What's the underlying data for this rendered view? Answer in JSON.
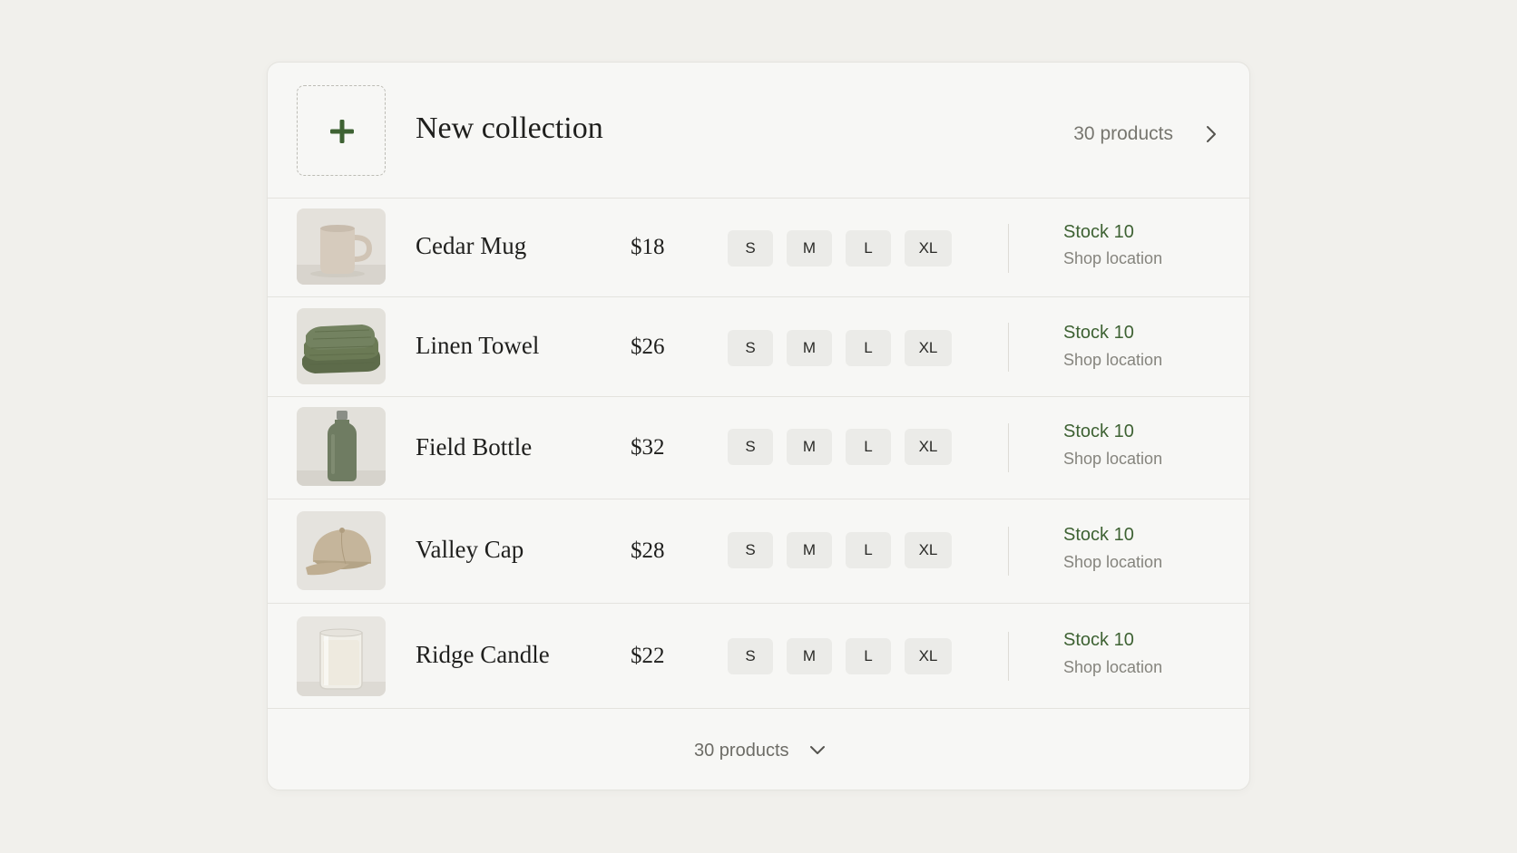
{
  "collection": {
    "title": "New collection",
    "count_label": "30 products",
    "add_icon": "plus-icon",
    "open_icon": "chevron-right-icon",
    "accent_color": "#3e6233"
  },
  "products": [
    {
      "name": "Cedar Mug",
      "price": "$18",
      "sizes": [
        "S",
        "M",
        "L",
        "XL"
      ],
      "stock": "Stock 10",
      "location": "Shop location",
      "image": "mug-image"
    },
    {
      "name": "Linen Towel",
      "price": "$26",
      "sizes": [
        "S",
        "M",
        "L",
        "XL"
      ],
      "stock": "Stock 10",
      "location": "Shop location",
      "image": "towel-image"
    },
    {
      "name": "Field Bottle",
      "price": "$32",
      "sizes": [
        "S",
        "M",
        "L",
        "XL"
      ],
      "stock": "Stock 10",
      "location": "Shop location",
      "image": "bottle-image"
    },
    {
      "name": "Valley Cap",
      "price": "$28",
      "sizes": [
        "S",
        "M",
        "L",
        "XL"
      ],
      "stock": "Stock 10",
      "location": "Shop location",
      "image": "cap-image"
    },
    {
      "name": "Ridge Candle",
      "price": "$22",
      "sizes": [
        "S",
        "M",
        "L",
        "XL"
      ],
      "stock": "Stock 10",
      "location": "Shop location",
      "image": "candle-image"
    }
  ],
  "footer": {
    "count_label": "30 products",
    "expand_icon": "chevron-down-icon"
  }
}
